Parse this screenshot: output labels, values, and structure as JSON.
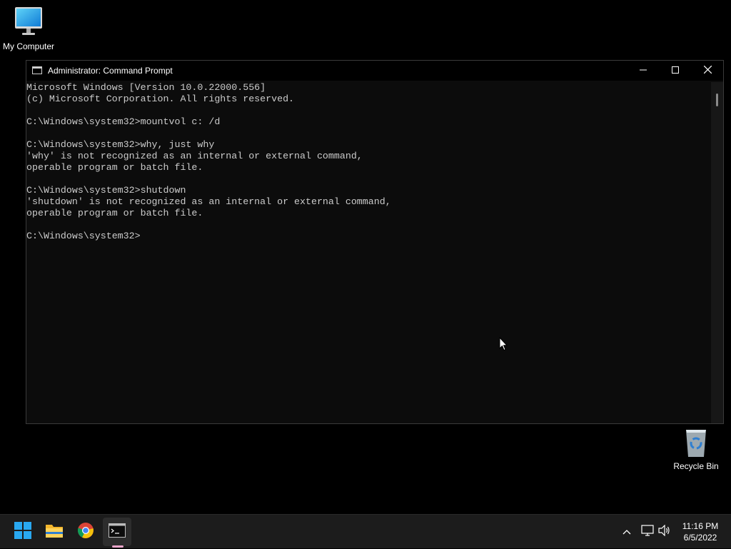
{
  "desktop": {
    "icons": [
      {
        "label": "My Computer"
      },
      {
        "label": "Recycle Bin"
      }
    ]
  },
  "window": {
    "title": "Administrator: Command Prompt",
    "controls": {
      "minimize": "minimize-icon",
      "maximize": "maximize-icon",
      "close": "close-icon"
    },
    "console_lines": [
      "Microsoft Windows [Version 10.0.22000.556]",
      "(c) Microsoft Corporation. All rights reserved.",
      "",
      "C:\\Windows\\system32>mountvol c: /d",
      "",
      "C:\\Windows\\system32>why, just why",
      "'why' is not recognized as an internal or external command,",
      "operable program or batch file.",
      "",
      "C:\\Windows\\system32>shutdown",
      "'shutdown' is not recognized as an internal or external command,",
      "operable program or batch file.",
      "",
      "C:\\Windows\\system32>"
    ]
  },
  "taskbar": {
    "apps": [
      {
        "name": "start",
        "icon": "windows-logo-icon"
      },
      {
        "name": "file-explorer",
        "icon": "folder-icon"
      },
      {
        "name": "chrome",
        "icon": "chrome-icon"
      },
      {
        "name": "command-prompt",
        "icon": "terminal-icon",
        "active": true
      }
    ],
    "tray": {
      "icons": [
        "chevron-up-icon",
        "network-icon",
        "volume-icon"
      ]
    },
    "clock": {
      "time": "11:16 PM",
      "date": "6/5/2022"
    }
  },
  "colors": {
    "console_bg": "#0c0c0c",
    "console_fg": "#cccccc",
    "taskbar_bg": "#1c1c1c",
    "active_indicator": "#e9a4c9"
  }
}
